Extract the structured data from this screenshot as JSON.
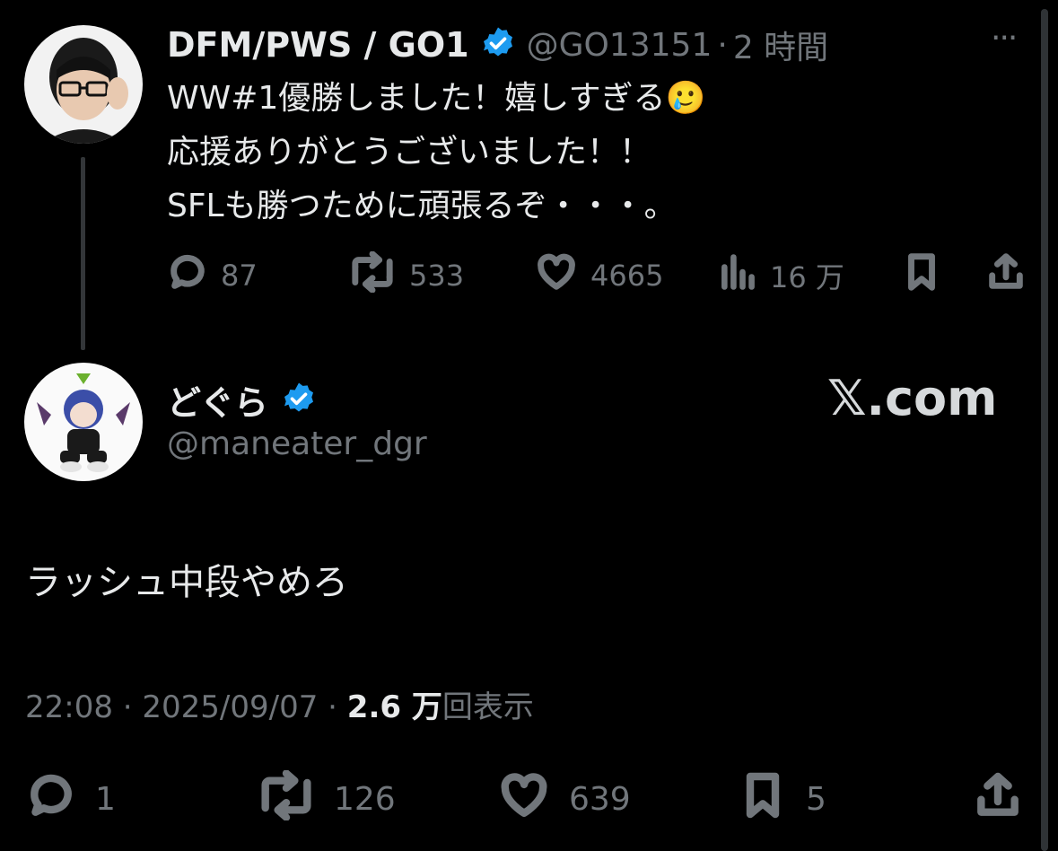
{
  "quoted_tweet": {
    "author_name": "DFM/PWS / GO1",
    "handle": "@GO13151",
    "separator": "·",
    "time": "2 時間",
    "lines": [
      "WW#1優勝しました！嬉しすぎる🥲",
      "応援ありがとうございました！！",
      "SFLも勝つために頑張るぞ・・・。"
    ],
    "more_label": "···",
    "actions": {
      "replies": "87",
      "retweets": "533",
      "likes": "4665",
      "views": "16 万"
    }
  },
  "reply_tweet": {
    "author_name": "どぐら",
    "handle": "@maneater_dgr",
    "text": "ラッシュ中段やめろ",
    "timestamp": "22:08 · 2025/09/07 · ",
    "view_count": "2.6 万",
    "view_suffix": "回表示",
    "actions": {
      "replies": "1",
      "retweets": "126",
      "likes": "639",
      "bookmarks": "5"
    }
  },
  "watermark": "𝕏.com",
  "colors": {
    "background": "#000000",
    "text": "#e7e9ea",
    "secondary": "#71767b",
    "verified": "#1d9bf0"
  },
  "icons": [
    "verified-badge-icon",
    "reply-icon",
    "retweet-icon",
    "like-icon",
    "views-icon",
    "bookmark-icon",
    "share-icon",
    "more-icon"
  ]
}
